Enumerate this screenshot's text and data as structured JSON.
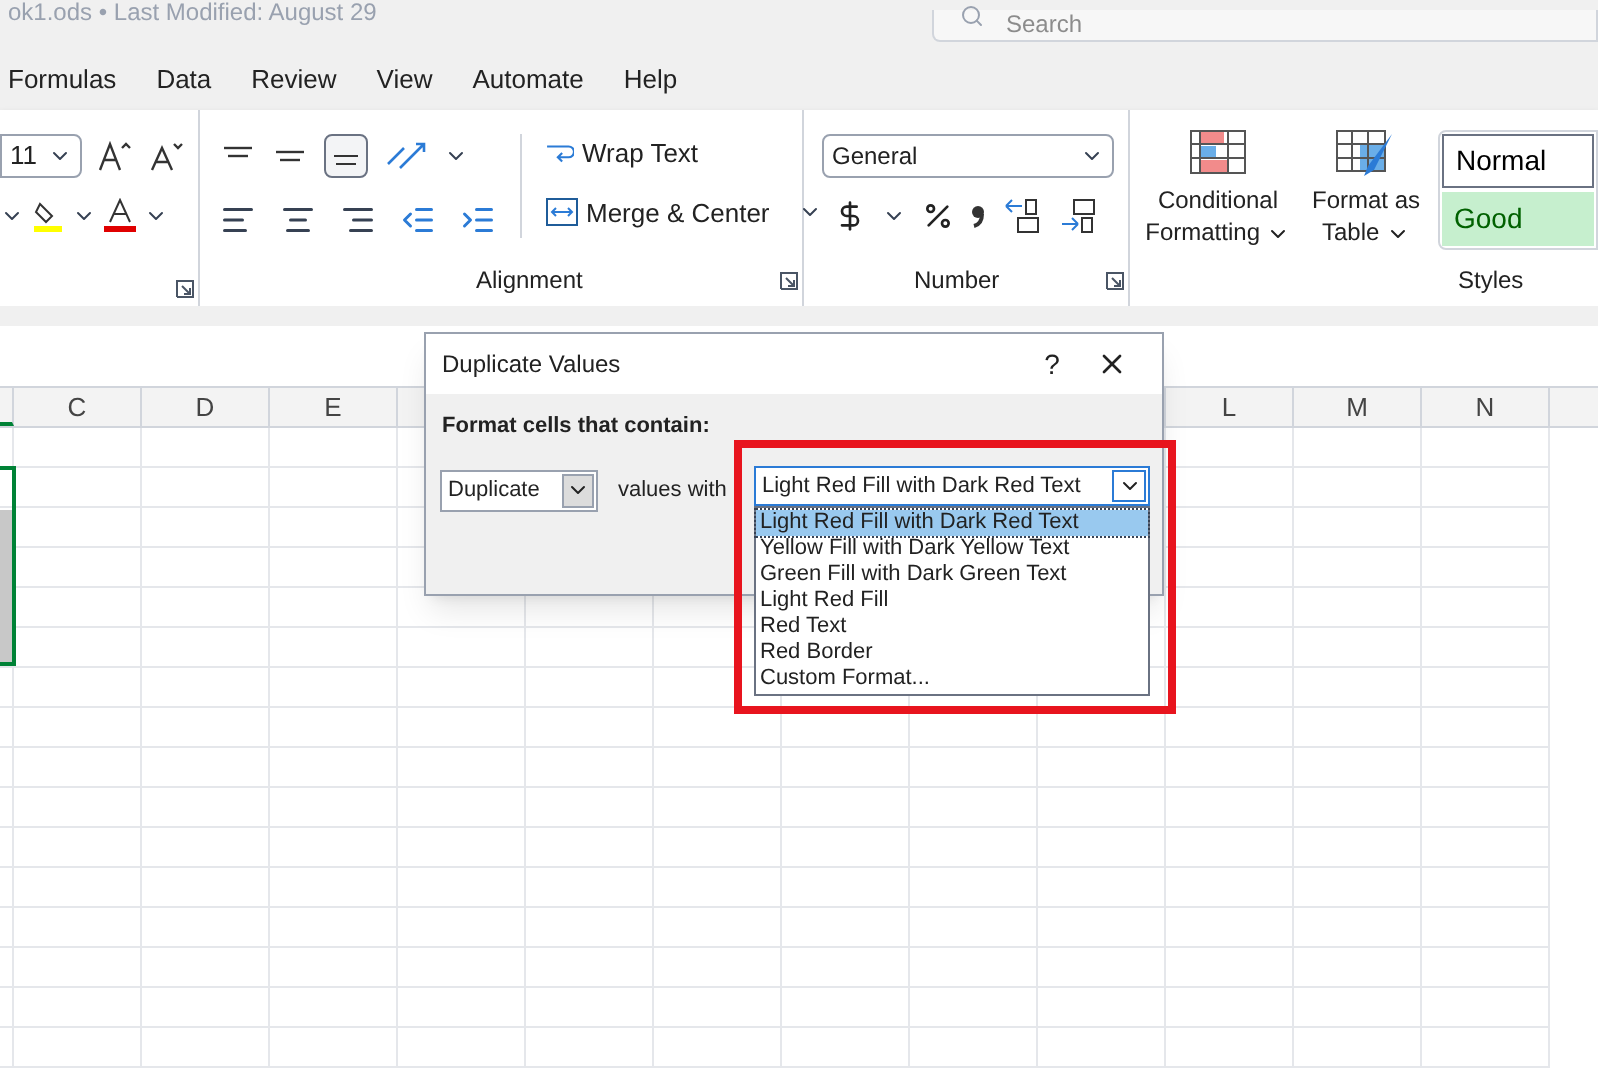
{
  "title_bar": {
    "title": "ok1.ods • Last Modified: August 29",
    "search": {
      "placeholder": "Search"
    }
  },
  "menu_tabs": [
    {
      "label": "Formulas",
      "selected": false
    },
    {
      "label": "Data",
      "selected": false
    },
    {
      "label": "Review",
      "selected": false
    },
    {
      "label": "View",
      "selected": false
    },
    {
      "label": "Automate",
      "selected": false
    },
    {
      "label": "Help",
      "selected": false
    }
  ],
  "ribbon": {
    "font": {
      "size": "11"
    },
    "alignment": {
      "label": "Alignment",
      "wrap_text": "Wrap Text",
      "merge": "Merge & Center"
    },
    "number": {
      "label": "Number",
      "format": "General"
    },
    "styles": {
      "label": "Styles",
      "conditional": "Conditional Formatting",
      "format_table": "Format as Table",
      "cells": [
        {
          "label": "Normal",
          "kind": "normal"
        },
        {
          "label": "Good",
          "kind": "good"
        }
      ]
    }
  },
  "sheet": {
    "columns_left": [
      "C",
      "D",
      "E"
    ],
    "columns_right": [
      "L",
      "M",
      "N"
    ]
  },
  "dialog": {
    "title": "Duplicate Values",
    "help": "?",
    "prompt": "Format cells that contain:",
    "rule": "Duplicate",
    "values_with": "values with",
    "format": "Light Red Fill with Dark Red Text",
    "open": true,
    "options": [
      {
        "label": "Light Red Fill with Dark Red Text",
        "selected": true
      },
      {
        "label": "Yellow Fill with Dark Yellow Text",
        "selected": false
      },
      {
        "label": "Green Fill with Dark Green Text",
        "selected": false
      },
      {
        "label": "Light Red Fill",
        "selected": false
      },
      {
        "label": "Red Text",
        "selected": false
      },
      {
        "label": "Red Border",
        "selected": false
      },
      {
        "label": "Custom Format...",
        "selected": false
      }
    ]
  }
}
